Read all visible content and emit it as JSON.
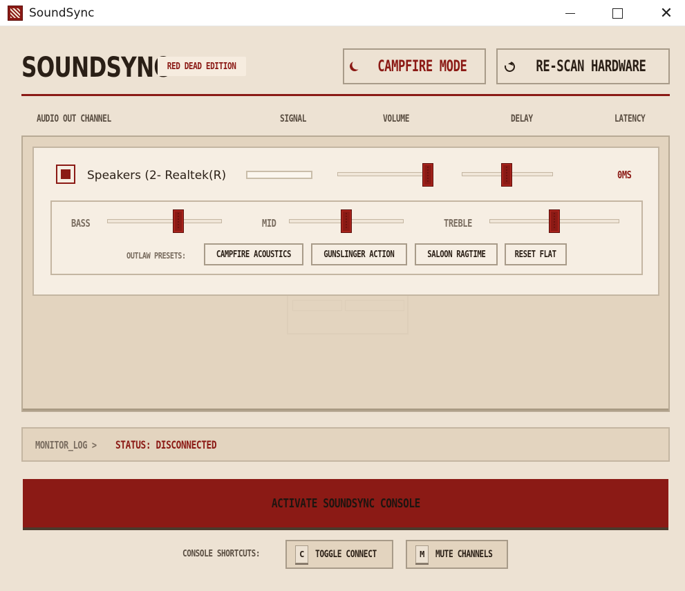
{
  "window": {
    "title": "SoundSync",
    "icon": "app-logo-icon"
  },
  "header": {
    "logo": "SOUNDSYNC",
    "edition": "RED DEAD EDITION",
    "campfire_button": "CAMPFIRE MODE",
    "campfire_icon": "moon-icon",
    "rescan_button": "RE-SCAN HARDWARE",
    "rescan_icon": "refresh-icon"
  },
  "columns": [
    "AUDIO OUT CHANNEL",
    "SIGNAL",
    "VOLUME",
    "DELAY",
    "LATENCY"
  ],
  "channel": {
    "enabled": true,
    "name": "Speakers (2- Realtek(R)",
    "signal_level": 0,
    "volume_fraction": 0.96,
    "delay_fraction": 0.49,
    "latency": "0MS"
  },
  "eq": {
    "bass_label": "BASS",
    "bass_fraction": 0.62,
    "mid_label": "MID",
    "mid_fraction": 0.5,
    "treble_label": "TREBLE",
    "treble_fraction": 0.5,
    "presets_label": "OUTLAW PRESETS:",
    "presets": [
      "CAMPFIRE ACOUSTICS",
      "GUNSLINGER ACTION",
      "SALOON RAGTIME",
      "RESET FLAT"
    ]
  },
  "log": {
    "prefix": "MONITOR_LOG >",
    "status": "STATUS: DISCONNECTED"
  },
  "activate_button": "ACTIVATE SOUNDSYNC CONSOLE",
  "shortcuts": {
    "label": "CONSOLE SHORTCUTS:",
    "items": [
      {
        "key": "C",
        "label": "TOGGLE CONNECT"
      },
      {
        "key": "M",
        "label": "MUTE CHANNELS"
      }
    ]
  },
  "colors": {
    "accent": "#8b1a15",
    "background": "#ede2d3",
    "panel": "#e3d4bf",
    "ink": "#2a1f16"
  }
}
